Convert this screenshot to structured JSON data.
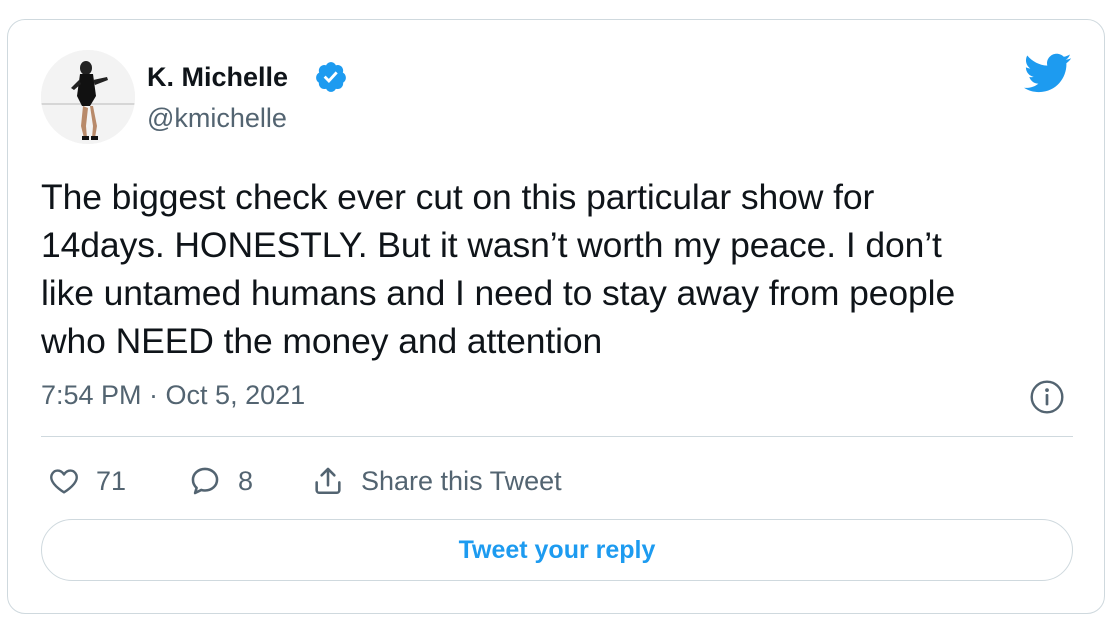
{
  "author": {
    "display_name": "K. Michelle",
    "handle": "@kmichelle",
    "verified": true,
    "avatar_icon": "profile-photo"
  },
  "tweet": {
    "text": "The biggest check ever cut on this particular show for\n14days. HONESTLY. But it wasn’t worth my peace. I don’t\nlike untamed humans and I need to stay away from people\nwho NEED the money and attention",
    "timestamp": "7:54 PM · Oct 5, 2021"
  },
  "actions": {
    "likes": "71",
    "replies": "8",
    "share_label": "Share this Tweet"
  },
  "reply_button_label": "Tweet your reply",
  "colors": {
    "brand": "#1d9bf0",
    "text": "#0f1419",
    "secondary": "#536471",
    "border": "#cfd9de"
  }
}
